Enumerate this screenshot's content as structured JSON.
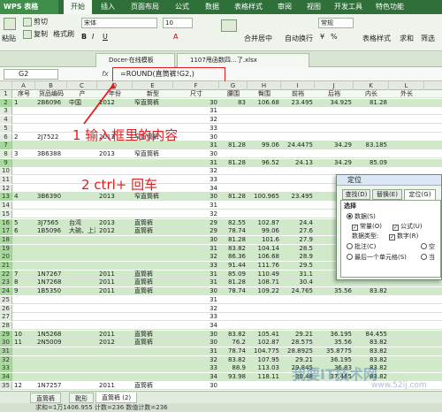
{
  "app": {
    "name": "WPS 表格"
  },
  "menu": [
    "开始",
    "插入",
    "页面布局",
    "公式",
    "数据",
    "表格样式",
    "审阅",
    "视图",
    "开发工具",
    "特色功能"
  ],
  "ribbon": {
    "paste": "粘贴",
    "cut": "剪切",
    "copy": "复制",
    "format_painter": "格式刷",
    "font_name": "宋体",
    "font_size": "10",
    "merge_center": "合并居中",
    "auto_wrap": "自动换行",
    "table_style": "表格样式",
    "sum": "求和",
    "filter": "筛选",
    "sort": "排序",
    "format": "格式",
    "number_format": "常规",
    "symbol_currency": "¥",
    "percent": "%"
  },
  "doc_tabs": [
    "Docer-在线模板",
    "1107甩函数四…了.xlsx"
  ],
  "formula_bar": {
    "cell": "G2",
    "fx": "fx",
    "formula": "=ROUND(直筒裤!G2,)"
  },
  "columns": [
    {
      "letter": "A",
      "header": "序号"
    },
    {
      "letter": "B",
      "header": "货品编码"
    },
    {
      "letter": "C",
      "header": "产"
    },
    {
      "letter": "D",
      "header": "年份"
    },
    {
      "letter": "E",
      "header": "新型"
    },
    {
      "letter": "F",
      "header": "尺寸"
    },
    {
      "letter": "G",
      "header": "腰围"
    },
    {
      "letter": "H",
      "header": "臀围"
    },
    {
      "letter": "I",
      "header": "前裆"
    },
    {
      "letter": "J",
      "header": "后裆"
    },
    {
      "letter": "K",
      "header": "内长"
    },
    {
      "letter": "L",
      "header": "外长"
    }
  ],
  "rows": [
    {
      "n": "2",
      "hl": true,
      "cells": [
        "1",
        "2B6096",
        "中国",
        "2012",
        "窄直筒裤",
        "30",
        "83",
        "106.68",
        "23.495",
        "34.925",
        "81.28",
        ""
      ]
    },
    {
      "n": "3",
      "hl": false,
      "cells": [
        "",
        "",
        "",
        "",
        "",
        "31",
        "",
        "",
        "",
        "",
        "",
        ""
      ]
    },
    {
      "n": "4",
      "hl": false,
      "cells": [
        "",
        "",
        "",
        "",
        "",
        "32",
        "",
        "",
        "",
        "",
        "",
        ""
      ]
    },
    {
      "n": "5",
      "hl": false,
      "cells": [
        "",
        "",
        "",
        "",
        "",
        "33",
        "",
        "",
        "",
        "",
        "",
        ""
      ]
    },
    {
      "n": "6",
      "hl": false,
      "cells": [
        "2",
        "2J7522",
        "",
        "2013",
        "窄直筒裤",
        "30",
        "",
        "",
        "",
        "",
        "",
        ""
      ]
    },
    {
      "n": "7",
      "hl": true,
      "cells": [
        "",
        "",
        "",
        "",
        "",
        "31",
        "81.28",
        "99.06",
        "24.4475",
        "34.29",
        "83.185",
        ""
      ]
    },
    {
      "n": "8",
      "hl": false,
      "cells": [
        "3",
        "3B6388",
        "",
        "2013",
        "窄直筒裤",
        "30",
        "",
        "",
        "",
        "",
        "",
        ""
      ]
    },
    {
      "n": "9",
      "hl": true,
      "cells": [
        "",
        "",
        "",
        "",
        "",
        "31",
        "81.28",
        "96.52",
        "24.13",
        "34.29",
        "85.09",
        ""
      ]
    },
    {
      "n": "10",
      "hl": false,
      "cells": [
        "",
        "",
        "",
        "",
        "",
        "32",
        "",
        "",
        "",
        "",
        "",
        ""
      ]
    },
    {
      "n": "11",
      "hl": false,
      "cells": [
        "",
        "",
        "",
        "",
        "",
        "33",
        "",
        "",
        "",
        "",
        "",
        ""
      ]
    },
    {
      "n": "12",
      "hl": false,
      "cells": [
        "",
        "",
        "",
        "",
        "",
        "34",
        "",
        "",
        "",
        "",
        "",
        ""
      ]
    },
    {
      "n": "13",
      "hl": true,
      "cells": [
        "4",
        "3B6390",
        "",
        "2013",
        "窄直筒裤",
        "30",
        "81.28",
        "100.965",
        "23.495",
        "",
        "",
        ""
      ]
    },
    {
      "n": "14",
      "hl": false,
      "cells": [
        "",
        "",
        "",
        "",
        "",
        "31",
        "",
        "",
        "",
        "",
        "",
        ""
      ]
    },
    {
      "n": "15",
      "hl": false,
      "cells": [
        "",
        "",
        "",
        "",
        "",
        "32",
        "",
        "",
        "",
        "",
        "",
        ""
      ]
    },
    {
      "n": "16",
      "hl": true,
      "cells": [
        "5",
        "3J7565",
        "台湾",
        "2013",
        "直筒裤",
        "29",
        "82.55",
        "102.87",
        "24.4",
        "",
        "",
        ""
      ]
    },
    {
      "n": "17",
      "hl": true,
      "cells": [
        "6",
        "1B5096",
        "大碗、上海",
        "2012",
        "直筒裤",
        "29",
        "78.74",
        "99.06",
        "27.6",
        "",
        "",
        ""
      ]
    },
    {
      "n": "18",
      "hl": true,
      "cells": [
        "",
        "",
        "",
        "",
        "",
        "30",
        "81.28",
        "101.6",
        "27.9",
        "",
        "",
        ""
      ]
    },
    {
      "n": "19",
      "hl": true,
      "cells": [
        "",
        "",
        "",
        "",
        "",
        "31",
        "83.82",
        "104.14",
        "28.5",
        "",
        "",
        ""
      ]
    },
    {
      "n": "20",
      "hl": true,
      "cells": [
        "",
        "",
        "",
        "",
        "",
        "32",
        "86.36",
        "106.68",
        "28.9",
        "",
        "",
        ""
      ]
    },
    {
      "n": "21",
      "hl": true,
      "cells": [
        "",
        "",
        "",
        "",
        "",
        "33",
        "91.44",
        "111.76",
        "29.5",
        "",
        "",
        ""
      ]
    },
    {
      "n": "22",
      "hl": true,
      "cells": [
        "7",
        "1N7267",
        "",
        "2011",
        "直筒裤",
        "31",
        "85.09",
        "110.49",
        "31.1",
        "",
        "",
        ""
      ]
    },
    {
      "n": "23",
      "hl": true,
      "cells": [
        "8",
        "1N7268",
        "",
        "2011",
        "直筒裤",
        "31",
        "81.28",
        "108.71",
        "30.4",
        "",
        "",
        ""
      ]
    },
    {
      "n": "24",
      "hl": true,
      "cells": [
        "9",
        "1B5350",
        "",
        "2011",
        "直筒裤",
        "30",
        "78.74",
        "109.22",
        "24.765",
        "35.56",
        "83.82",
        ""
      ]
    },
    {
      "n": "25",
      "hl": false,
      "cells": [
        "",
        "",
        "",
        "",
        "",
        "31",
        "",
        "",
        "",
        "",
        "",
        ""
      ]
    },
    {
      "n": "26",
      "hl": false,
      "cells": [
        "",
        "",
        "",
        "",
        "",
        "32",
        "",
        "",
        "",
        "",
        "",
        ""
      ]
    },
    {
      "n": "27",
      "hl": false,
      "cells": [
        "",
        "",
        "",
        "",
        "",
        "33",
        "",
        "",
        "",
        "",
        "",
        ""
      ]
    },
    {
      "n": "28",
      "hl": false,
      "cells": [
        "",
        "",
        "",
        "",
        "",
        "34",
        "",
        "",
        "",
        "",
        "",
        ""
      ]
    },
    {
      "n": "29",
      "hl": true,
      "cells": [
        "10",
        "1N5268",
        "",
        "2011",
        "直筒裤",
        "30",
        "83.82",
        "105.41",
        "29.21",
        "36.195",
        "84.455",
        ""
      ]
    },
    {
      "n": "30",
      "hl": true,
      "cells": [
        "11",
        "2N5009",
        "",
        "2012",
        "直筒裤",
        "30",
        "76.2",
        "102.87",
        "28.575",
        "35.56",
        "83.82",
        ""
      ]
    },
    {
      "n": "31",
      "hl": true,
      "cells": [
        "",
        "",
        "",
        "",
        "",
        "31",
        "78.74",
        "104.775",
        "28.8925",
        "35.8775",
        "83.82",
        ""
      ]
    },
    {
      "n": "32",
      "hl": true,
      "cells": [
        "",
        "",
        "",
        "",
        "",
        "32",
        "83.82",
        "107.95",
        "29.21",
        "36.195",
        "83.82",
        ""
      ]
    },
    {
      "n": "33",
      "hl": true,
      "cells": [
        "",
        "",
        "",
        "",
        "",
        "33",
        "88.9",
        "113.03",
        "29.845",
        "36.83",
        "83.82",
        ""
      ]
    },
    {
      "n": "34",
      "hl": true,
      "cells": [
        "",
        "",
        "",
        "",
        "",
        "34",
        "93.98",
        "118.11",
        "30.48",
        "37.465",
        "83.82",
        ""
      ]
    },
    {
      "n": "35",
      "hl": false,
      "cells": [
        "12",
        "1N7257",
        "",
        "2011",
        "直筒裤",
        "30",
        "",
        "",
        "",
        "",
        "",
        ""
      ]
    }
  ],
  "annotations": {
    "step1": "1 输入框里的内容",
    "step2": "2 ctrl+ 回车"
  },
  "dialog": {
    "title": "定位",
    "tabs": [
      "查找(D)",
      "替换(E)",
      "定位(G)"
    ],
    "section": "选择",
    "opt_data": "数据(S)",
    "opt_constant": "常量(O)",
    "opt_formula": "公式(U)",
    "data_type": "数据类型:",
    "opt_number": "数字(R)",
    "opt_comment": "批注(C)",
    "opt_null": "空",
    "opt_last_cell": "最后一个单元格(S)",
    "opt_current": "当"
  },
  "sheets": [
    "直筒裤",
    "靴形",
    "直筒裤 (2)"
  ],
  "status": "求和=1万1406.955   计数=236   数值计数=236",
  "watermark": "我要IT技术网",
  "watermark_sub": "www.52ij.com",
  "colors": {
    "accent": "#2f6f3a",
    "highlight": "#cfe9c9",
    "annotation": "#e02020"
  }
}
